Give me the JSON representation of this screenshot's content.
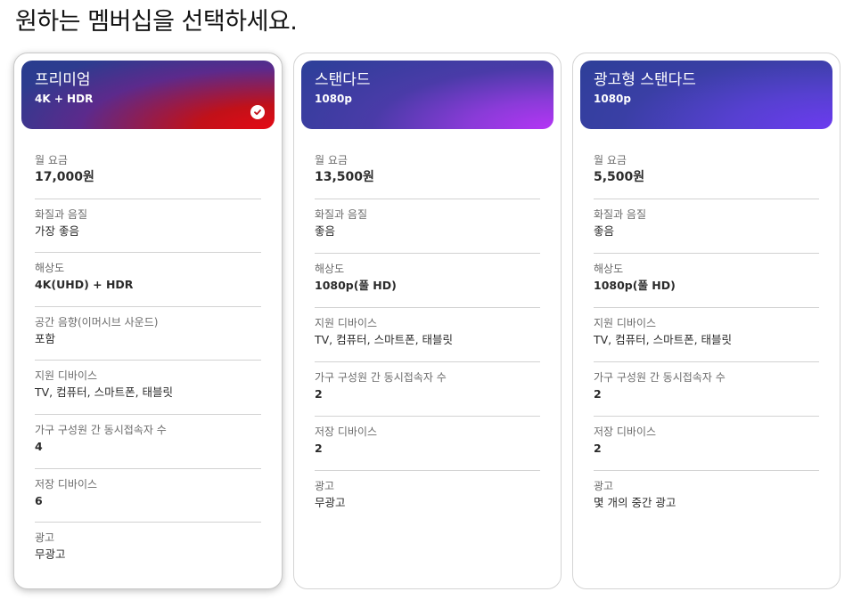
{
  "page": {
    "title": "원하는 멤버십을 선택하세요."
  },
  "plans": [
    {
      "name": "프리미엄",
      "quality_badge": "4K + HDR",
      "selected": true,
      "features": [
        {
          "label": "월 요금",
          "value": "17,000원"
        },
        {
          "label": "화질과 음질",
          "value": "가장 좋음"
        },
        {
          "label": "해상도",
          "value": "4K(UHD) + HDR"
        },
        {
          "label": "공간 음향(이머시브 사운드)",
          "value": "포함"
        },
        {
          "label": "지원 디바이스",
          "value": "TV, 컴퓨터, 스마트폰, 태블릿"
        },
        {
          "label": "가구 구성원 간 동시접속자 수",
          "value": "4"
        },
        {
          "label": "저장 디바이스",
          "value": "6"
        },
        {
          "label": "광고",
          "value": "무광고"
        }
      ]
    },
    {
      "name": "스탠다드",
      "quality_badge": "1080p",
      "selected": false,
      "features": [
        {
          "label": "월 요금",
          "value": "13,500원"
        },
        {
          "label": "화질과 음질",
          "value": "좋음"
        },
        {
          "label": "해상도",
          "value": "1080p(풀 HD)"
        },
        {
          "label": "지원 디바이스",
          "value": "TV, 컴퓨터, 스마트폰, 태블릿"
        },
        {
          "label": "가구 구성원 간 동시접속자 수",
          "value": "2"
        },
        {
          "label": "저장 디바이스",
          "value": "2"
        },
        {
          "label": "광고",
          "value": "무광고"
        }
      ]
    },
    {
      "name": "광고형 스탠다드",
      "quality_badge": "1080p",
      "selected": false,
      "features": [
        {
          "label": "월 요금",
          "value": "5,500원"
        },
        {
          "label": "화질과 음질",
          "value": "좋음"
        },
        {
          "label": "해상도",
          "value": "1080p(풀 HD)"
        },
        {
          "label": "지원 디바이스",
          "value": "TV, 컴퓨터, 스마트폰, 태블릿"
        },
        {
          "label": "가구 구성원 간 동시접속자 수",
          "value": "2"
        },
        {
          "label": "저장 디바이스",
          "value": "2"
        },
        {
          "label": "광고",
          "value": "몇 개의 중간 광고"
        }
      ]
    }
  ],
  "icons": {
    "selected_check": "check-circle-icon"
  },
  "colors": {
    "brand_red": "#e50914",
    "text": "#141414",
    "label_gray": "#6b6b6b"
  }
}
